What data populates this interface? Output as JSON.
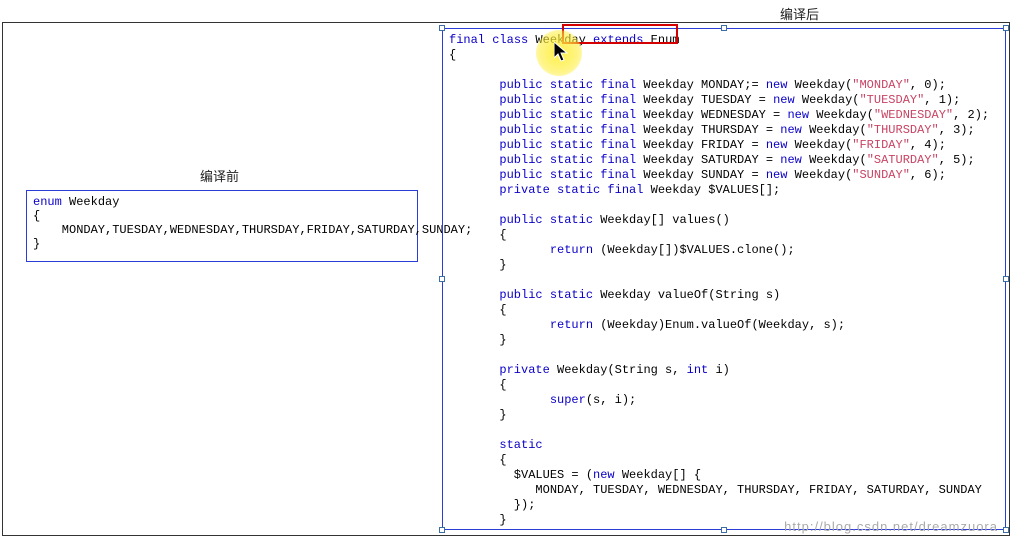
{
  "headers": {
    "before": "编译前",
    "after": "编译后"
  },
  "left": {
    "l1a": "enum",
    "l1b": " Weekday",
    "l2": "{",
    "l3": "    MONDAY,TUESDAY,WEDNESDAY,THURSDAY,FRIDAY,SATURDAY,SUNDAY;",
    "l4": "}"
  },
  "right": {
    "r1_kw1": "final",
    "r1_kw2": "class",
    "r1_cls": " Weekday ",
    "r1_kw3": "extends",
    "r1_sup": " Enum",
    "brace_open": "{",
    "f1_pre": "       public static final",
    "f1_mid": " Weekday MONDAY;= ",
    "f1_new": "new",
    "f1_post": " Weekday(",
    "f1_str": "\"MONDAY\"",
    "f1_end": ", 0);",
    "f2_pre": "       public static final",
    "f2_mid": " Weekday TUESDAY = ",
    "f2_new": "new",
    "f2_post": " Weekday(",
    "f2_str": "\"TUESDAY\"",
    "f2_end": ", 1);",
    "f3_pre": "       public static final",
    "f3_mid": " Weekday WEDNESDAY = ",
    "f3_new": "new",
    "f3_post": " Weekday(",
    "f3_str": "\"WEDNESDAY\"",
    "f3_end": ", 2);",
    "f4_pre": "       public static final",
    "f4_mid": " Weekday THURSDAY = ",
    "f4_new": "new",
    "f4_post": " Weekday(",
    "f4_str": "\"THURSDAY\"",
    "f4_end": ", 3);",
    "f5_pre": "       public static final",
    "f5_mid": " Weekday FRIDAY = ",
    "f5_new": "new",
    "f5_post": " Weekday(",
    "f5_str": "\"FRIDAY\"",
    "f5_end": ", 4);",
    "f6_pre": "       public static final",
    "f6_mid": " Weekday SATURDAY = ",
    "f6_new": "new",
    "f6_post": " Weekday(",
    "f6_str": "\"SATURDAY\"",
    "f6_end": ", 5);",
    "f7_pre": "       public static final",
    "f7_mid": " Weekday SUNDAY = ",
    "f7_new": "new",
    "f7_post": " Weekday(",
    "f7_str": "\"SUNDAY\"",
    "f7_end": ", 6);",
    "f8_pre": "       private static final",
    "f8_post": " Weekday $VALUES[];",
    "m1_pre": "       public static",
    "m1_post": " Weekday[] values()",
    "m1_b1": "       {",
    "m1_ret_kw": "              return",
    "m1_ret": " (Weekday[])$VALUES.clone();",
    "m1_b2": "       }",
    "m2_pre": "       public static",
    "m2_post": " Weekday valueOf(String s)",
    "m2_b1": "       {",
    "m2_ret_kw": "              return",
    "m2_ret": " (Weekday)Enum.valueOf(Weekday, s);",
    "m2_b2": "       }",
    "m3_pre": "       private",
    "m3_sig": " Weekday(String s, ",
    "m3_int": "int",
    "m3_sig2": " i)",
    "m3_b1": "       {",
    "m3_call_kw": "              super",
    "m3_call": "(s, i);",
    "m3_b2": "       }",
    "st_kw": "       static",
    "st_b1": "       {",
    "st_line1a": "         $VALUES = (",
    "st_line1new": "new",
    "st_line1b": " Weekday[] {",
    "st_line2": "            MONDAY, TUESDAY, WEDNESDAY, THURSDAY, FRIDAY, SATURDAY, SUNDAY",
    "st_line3": "         });",
    "st_b2": "       }",
    "brace_close": "}"
  },
  "watermark": "http://blog.csdn.net/dreamzuora"
}
